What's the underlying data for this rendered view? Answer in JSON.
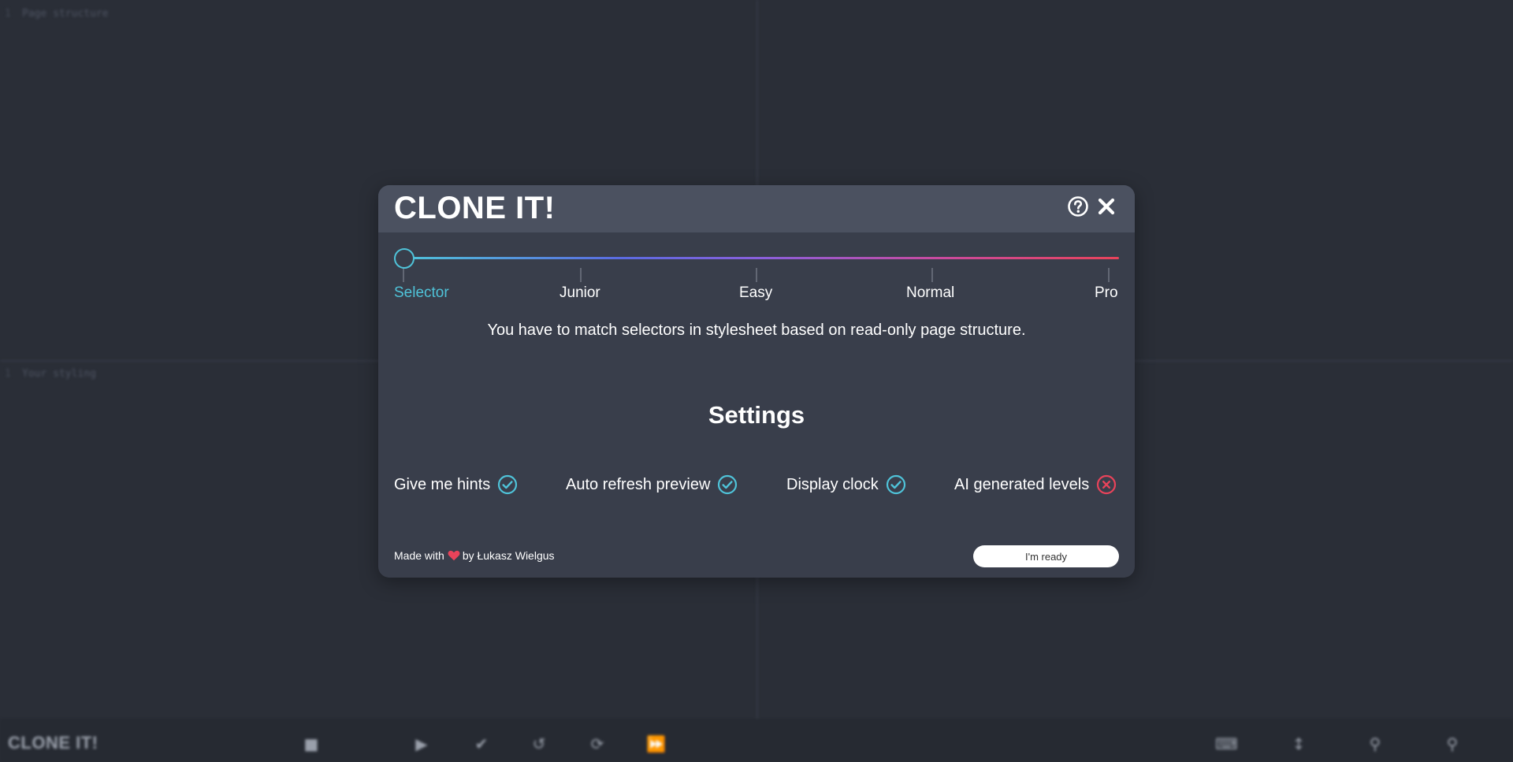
{
  "background": {
    "top_pane_label": "Page structure",
    "bottom_pane_label": "Your styling",
    "gutter_marker": "1",
    "logo": "CLONE IT!"
  },
  "modal": {
    "title": "CLONE IT!",
    "difficulty": {
      "selected": "Selector",
      "levels": [
        "Selector",
        "Junior",
        "Easy",
        "Normal",
        "Pro"
      ]
    },
    "description": "You have to match selectors in stylesheet based on read-only page structure.",
    "settings_title": "Settings",
    "settings": [
      {
        "label": "Give me hints",
        "enabled": true
      },
      {
        "label": "Auto refresh preview",
        "enabled": true
      },
      {
        "label": "Display clock",
        "enabled": true
      },
      {
        "label": "AI generated levels",
        "enabled": false
      }
    ],
    "footer": {
      "made_with": "Made with",
      "by": "by Łukasz Wielgus",
      "ready_label": "I'm ready"
    }
  },
  "colors": {
    "accent": "#4fc3d9",
    "danger": "#e8435a",
    "modal_bg": "#393e4b",
    "header_bg": "#4b5160",
    "page_bg": "#2a2e37"
  },
  "icons": {
    "help": "help-circle-icon",
    "close": "close-icon",
    "enabled": "check-circle-icon",
    "disabled": "x-circle-icon",
    "heart": "heart-icon",
    "toolbar": [
      "stop-icon",
      "play-icon",
      "check-icon",
      "undo-icon",
      "refresh-icon",
      "fast-forward-icon",
      "keyboard-icon",
      "vertical-resize-icon",
      "zoom-out-icon",
      "zoom-in-icon"
    ]
  }
}
